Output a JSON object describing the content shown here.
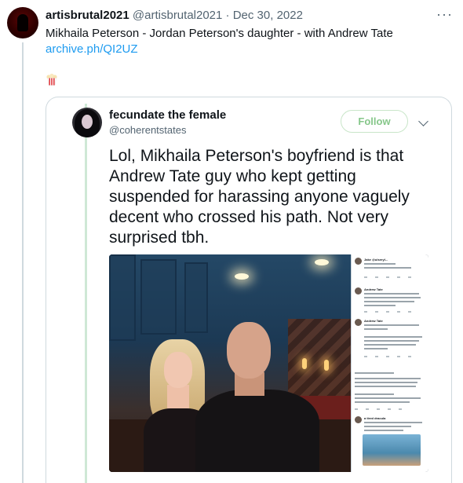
{
  "tweet": {
    "author_name": "artisbrutal2021",
    "author_handle": "@artisbrutal2021",
    "separator": "·",
    "date": "Dec 30, 2022",
    "more_icon": "more-horizontal-icon",
    "text": "Mikhaila Peterson - Jordan Peterson's daughter - with Andrew Tate",
    "link": "archive.ph/QI2UZ",
    "emoji": "popcorn-emoji"
  },
  "quoted": {
    "author_name": "fecundate the female",
    "author_handle": "@coherentstates",
    "follow_label": "Follow",
    "chevron_icon": "chevron-down-icon",
    "text": "Lol, Mikhaila Peterson's boyfriend is that Andrew Tate guy who kept getting suspended for harassing anyone vaguely decent who crossed his path. Not very surprised tbh.",
    "media": {
      "photo": "photo-man-and-woman",
      "embedded_screenshot": {
        "items": [
          {
            "name": "Jake @ulseryl..."
          },
          {
            "name": "Andrew Tate"
          },
          {
            "name": "Andrew Tate"
          },
          {
            "name": "a tired dracula"
          }
        ]
      }
    }
  },
  "colors": {
    "accent_link": "#1d9bf0",
    "follow_text": "#86c78a",
    "secondary_text": "#536471",
    "border": "#cfd9de"
  }
}
